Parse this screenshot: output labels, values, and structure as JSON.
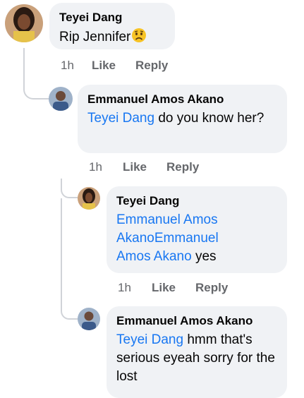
{
  "comments": [
    {
      "author": "Teyei Dang",
      "text": "Rip Jennifer",
      "emoji": "worried-face-emoji",
      "time": "1h",
      "like": "Like",
      "reply": "Reply"
    },
    {
      "author": "Emmanuel Amos Akano",
      "mention": "Teyei Dang",
      "text": " do you know her?",
      "time": "1h",
      "like": "Like",
      "reply": "Reply"
    },
    {
      "author": "Teyei Dang",
      "mention": "Emmanuel Amos AkanoEmmanuel Amos Akano",
      "text": " yes",
      "time": "1h",
      "like": "Like",
      "reply": "Reply"
    },
    {
      "author": "Emmanuel Amos Akano",
      "mention": "Teyei Dang",
      "text": " hmm that's serious eyeah sorry for the lost"
    }
  ]
}
